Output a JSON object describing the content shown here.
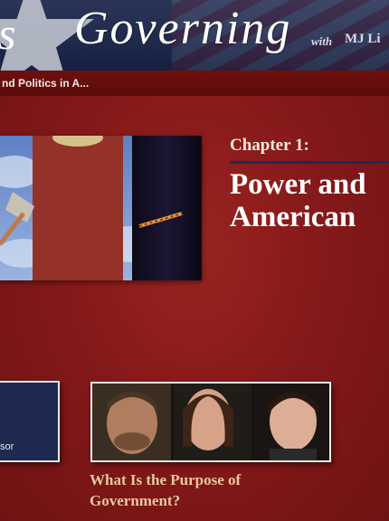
{
  "header": {
    "logo_left_fragment": "s",
    "logo_main": "Governing",
    "logo_with": "with",
    "logo_name": "MJ Li"
  },
  "subbar": {
    "subtitle": "nd Politics in A..."
  },
  "chapter": {
    "label": "Chapter 1:",
    "title": "Power and\nAmerican"
  },
  "card_left": {
    "text": "sor"
  },
  "featured_video": {
    "title": "What Is the Purpose of Government?"
  },
  "colors": {
    "background_red": "#7d1513",
    "header_navy": "#1f2a4d",
    "chapter_rule": "#1f2a55",
    "video_title": "#e8c9a0"
  }
}
